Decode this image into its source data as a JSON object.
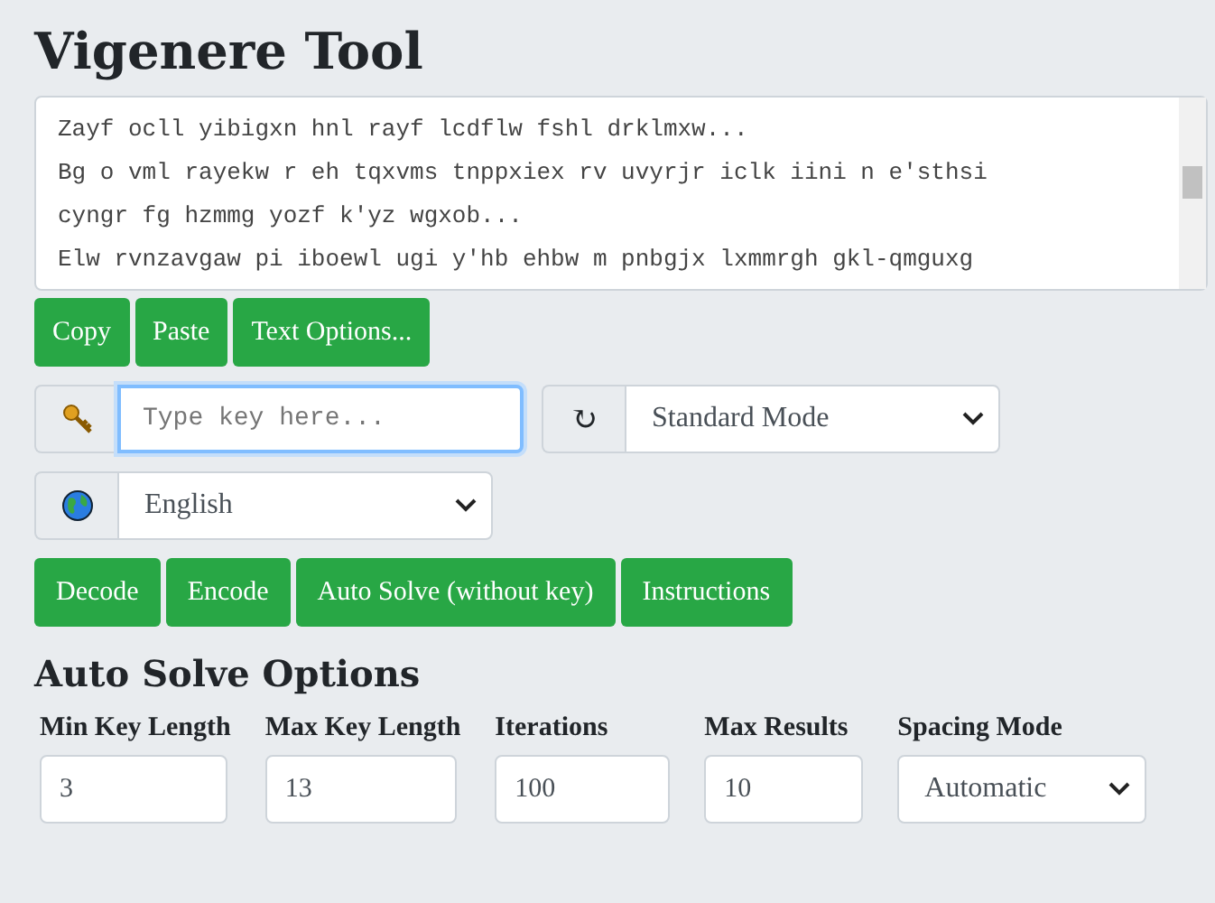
{
  "title": "Vigenere Tool",
  "text_area": {
    "lines": [
      "Zayf ocll yibigxn hnl rayf lcdflw fshl drklmxw...",
      "Bg o vml rayekw r eh tqxvms tnppxiex rv uvyrjr iclk iini n e'sthsi",
      "cyngr fg hzmmg yozf k'yz wgxob...",
      "Elw rvnzavgaw pi iboewl ugi y'hb ehbw m pnbgjx lxmmrgh gkl-qmguxg"
    ]
  },
  "text_buttons": [
    "Copy",
    "Paste",
    "Text Options..."
  ],
  "key_field": {
    "placeholder": "Type key here..."
  },
  "mode_select": {
    "value": "Standard Mode",
    "icon": "↻"
  },
  "language_select": {
    "value": "English"
  },
  "action_buttons": [
    "Decode",
    "Encode",
    "Auto Solve (without key)",
    "Instructions"
  ],
  "options_heading": "Auto Solve Options",
  "options": [
    {
      "kind": "input",
      "label": "Min Key Length",
      "value": "3"
    },
    {
      "kind": "input",
      "label": "Max Key Length",
      "value": "13"
    },
    {
      "kind": "input",
      "label": "Iterations",
      "value": "100"
    },
    {
      "kind": "input",
      "label": "Max Results",
      "value": "10"
    },
    {
      "kind": "select",
      "label": "Spacing Mode",
      "value": "Automatic"
    }
  ]
}
